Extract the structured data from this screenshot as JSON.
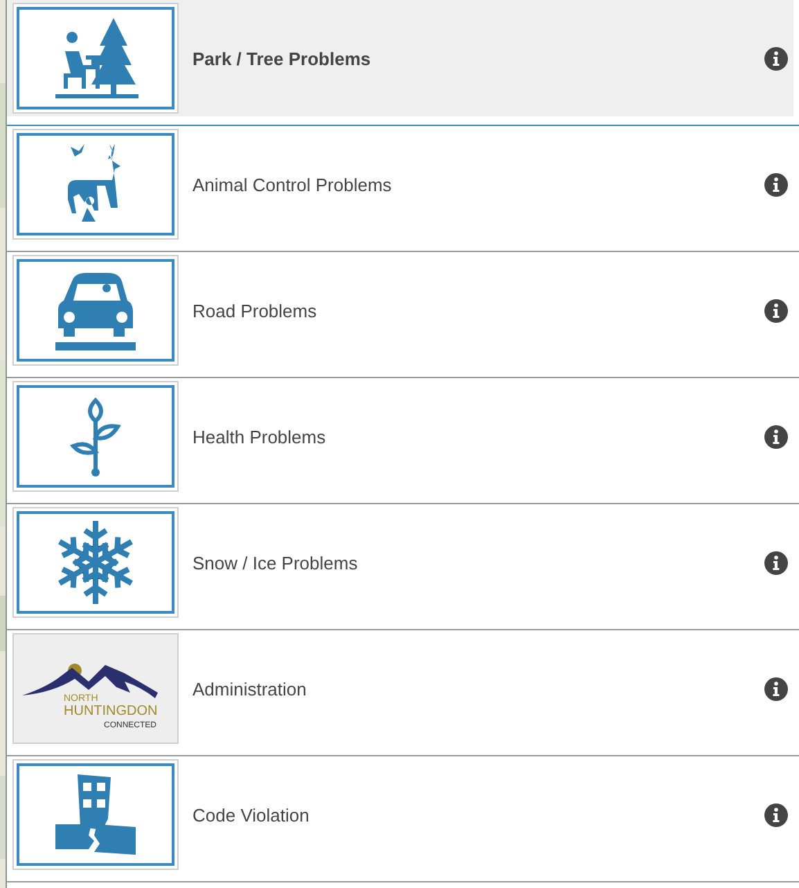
{
  "categories": [
    {
      "label": "Park / Tree Problems",
      "selected": true,
      "kind": "icon"
    },
    {
      "label": "Animal Control Problems",
      "selected": false,
      "kind": "icon"
    },
    {
      "label": "Road Problems",
      "selected": false,
      "kind": "icon"
    },
    {
      "label": "Health Problems",
      "selected": false,
      "kind": "icon"
    },
    {
      "label": "Snow / Ice Problems",
      "selected": false,
      "kind": "icon"
    },
    {
      "label": "Administration",
      "selected": false,
      "kind": "logo",
      "logo_lines": [
        "NORTH",
        "HUNTINGDON",
        "CONNECTED"
      ]
    },
    {
      "label": "Code Violation",
      "selected": false,
      "kind": "icon"
    }
  ]
}
